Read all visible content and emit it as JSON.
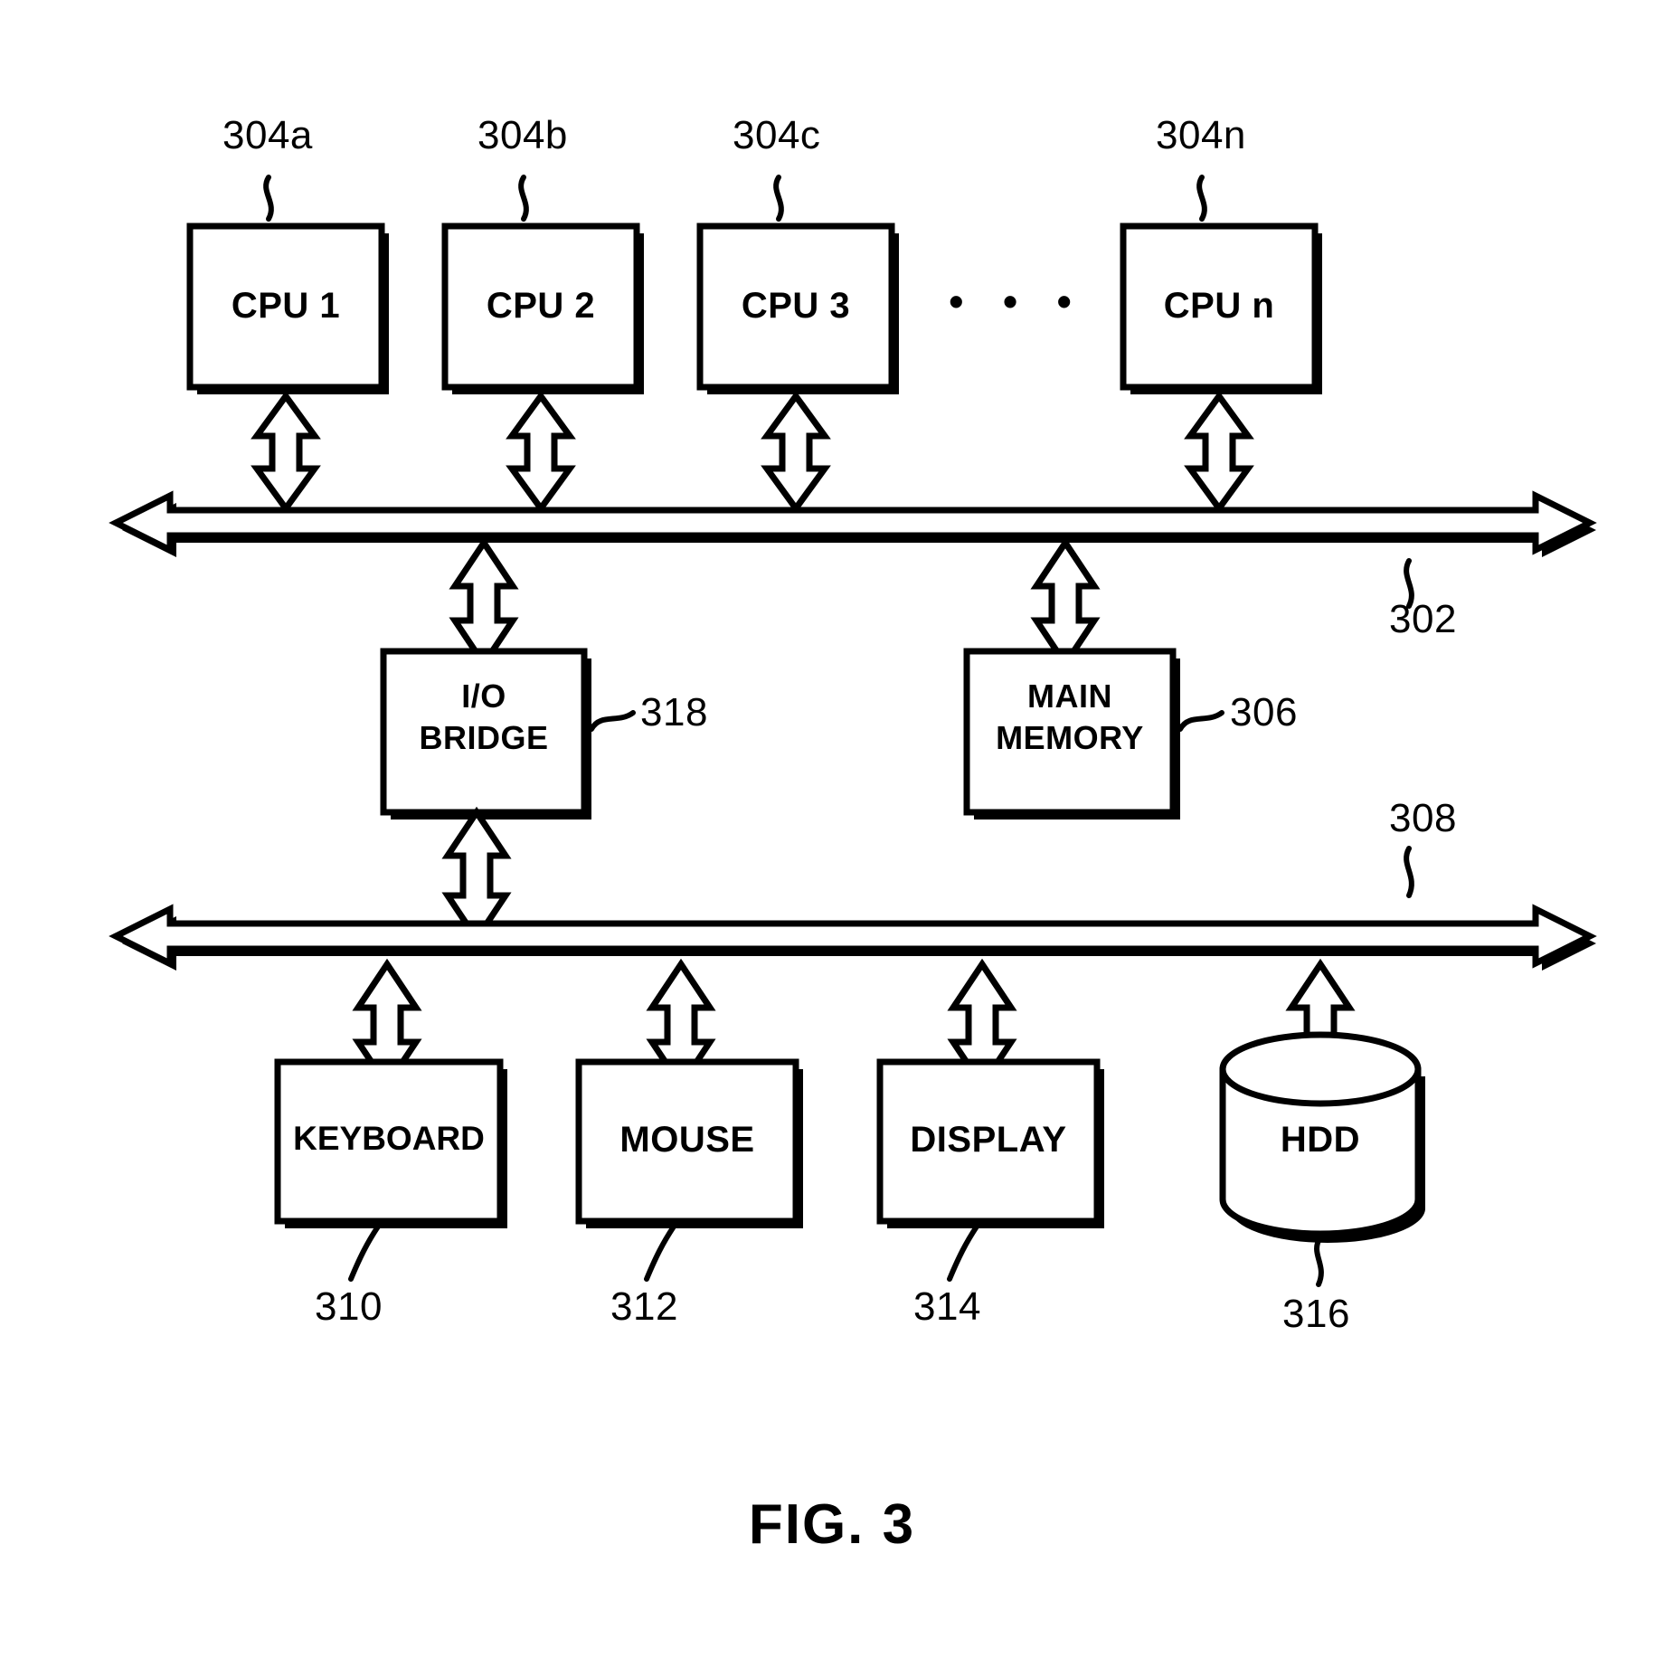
{
  "figure": {
    "caption": "FIG. 3",
    "background_color": "#ffffff",
    "line_color": "#000000"
  },
  "processors": {
    "ellipsis": "•  •  •",
    "items": [
      {
        "label": "CPU 1",
        "ref": "304a"
      },
      {
        "label": "CPU 2",
        "ref": "304b"
      },
      {
        "label": "CPU 3",
        "ref": "304c"
      },
      {
        "label": "CPU n",
        "ref": "304n"
      }
    ]
  },
  "buses": [
    {
      "name": "system-bus",
      "ref": "302"
    },
    {
      "name": "io-bus",
      "ref": "308"
    }
  ],
  "middle_blocks": [
    {
      "label_line1": "I/O",
      "label_line2": "BRIDGE",
      "ref": "318"
    },
    {
      "label_line1": "MAIN",
      "label_line2": "MEMORY",
      "ref": "306"
    }
  ],
  "io_devices": [
    {
      "label": "KEYBOARD",
      "ref": "310",
      "shape": "rect"
    },
    {
      "label": "MOUSE",
      "ref": "312",
      "shape": "rect"
    },
    {
      "label": "DISPLAY",
      "ref": "314",
      "shape": "rect"
    },
    {
      "label": "HDD",
      "ref": "316",
      "shape": "cylinder"
    }
  ]
}
